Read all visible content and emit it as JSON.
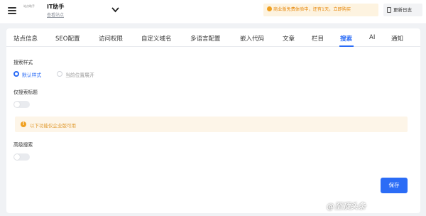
{
  "header": {
    "logo_text": "站点助手",
    "site_name": "IT助手",
    "site_link": "查看站点",
    "trial_prefix": "商业版免费体验中，还有1天，",
    "trial_link": "立即购买",
    "changelog": "更新日志"
  },
  "tabs": [
    {
      "label": "站点信息"
    },
    {
      "label": "SEO配置"
    },
    {
      "label": "访问权限"
    },
    {
      "label": "自定义域名"
    },
    {
      "label": "多语言配置"
    },
    {
      "label": "嵌入代码"
    },
    {
      "label": "文章"
    },
    {
      "label": "栏目"
    },
    {
      "label": "搜索"
    },
    {
      "label": "AI"
    },
    {
      "label": "通知"
    }
  ],
  "active_tab": "搜索",
  "form": {
    "search_style_label": "搜索样式",
    "options": [
      {
        "label": "默认样式",
        "checked": true
      },
      {
        "label": "当前位置展开",
        "checked": false
      }
    ],
    "title_only_label": "仅搜索标题",
    "title_only_enabled": false,
    "notice": "以下功能仅企业版可用",
    "advanced_label": "高级搜索",
    "advanced_enabled": false,
    "save_label": "保存"
  },
  "watermark": "@至顶头条",
  "colors": {
    "accent": "#2b6cf6",
    "warning": "#e6870a",
    "notice_bg": "#fdf5e8"
  }
}
